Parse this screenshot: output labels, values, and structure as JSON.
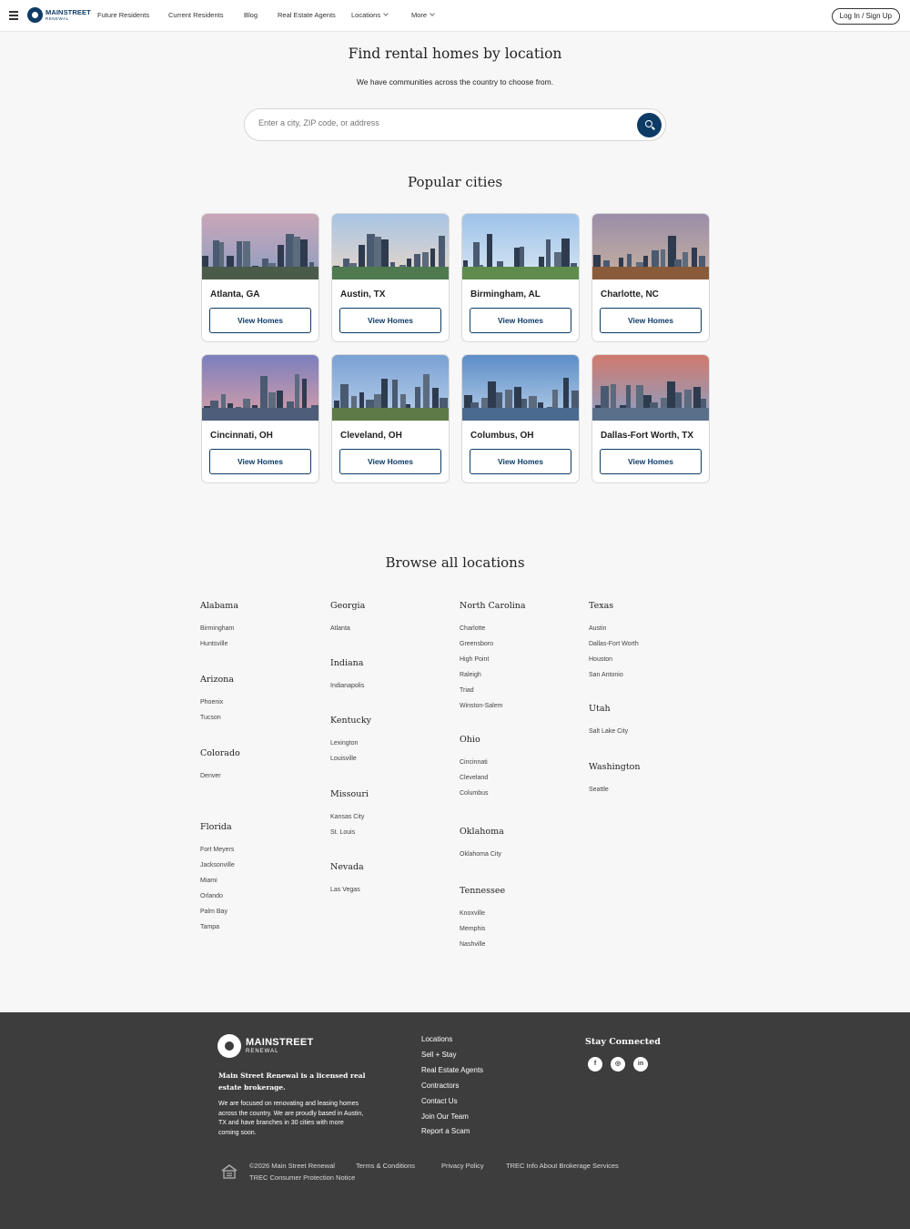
{
  "nav": {
    "brand_line1": "MAINSTREET",
    "brand_line2": "RENEWAL",
    "links": [
      "Future Residents",
      "Current Residents",
      "Blog",
      "Real Estate Agents",
      "Locations",
      "More"
    ],
    "login": "Log In / Sign Up"
  },
  "hero": {
    "title": "Find rental homes by location",
    "subtitle": "We have communities across the country to choose from.",
    "search_placeholder": "Enter a city, ZIP code, or address"
  },
  "popular": {
    "title": "Popular cities",
    "button_label": "View Homes",
    "cities": [
      "Atlanta, GA",
      "Austin, TX",
      "Birmingham, AL",
      "Charlotte, NC",
      "Cincinnati, OH",
      "Cleveland, OH",
      "Columbus, OH",
      "Dallas-Fort Worth, TX"
    ]
  },
  "browse": {
    "title": "Browse all locations",
    "states": [
      {
        "name": "Alabama",
        "cities": [
          "Birmingham",
          "Huntsville"
        ]
      },
      {
        "name": "Arizona",
        "cities": [
          "Phoenix",
          "Tucson"
        ]
      },
      {
        "name": "Colorado",
        "cities": [
          "Denver"
        ]
      },
      {
        "name": "Florida",
        "cities": [
          "Fort Meyers",
          "Jacksonville",
          "Miami",
          "Orlando",
          "Palm Bay",
          "Tampa"
        ]
      },
      {
        "name": "Georgia",
        "cities": [
          "Atlanta"
        ]
      },
      {
        "name": "Indiana",
        "cities": [
          "Indianapolis"
        ]
      },
      {
        "name": "Kentucky",
        "cities": [
          "Lexington",
          "Louisville"
        ]
      },
      {
        "name": "Missouri",
        "cities": [
          "Kansas City",
          "St. Louis"
        ]
      },
      {
        "name": "Nevada",
        "cities": [
          "Las Vegas"
        ]
      },
      {
        "name": "North Carolina",
        "cities": [
          "Charlotte",
          "Greensboro",
          "High Point",
          "Raleigh",
          "Triad",
          "Winston-Salem"
        ]
      },
      {
        "name": "Ohio",
        "cities": [
          "Cincinnati",
          "Cleveland",
          "Columbus"
        ]
      },
      {
        "name": "Oklahoma",
        "cities": [
          "Oklahoma City"
        ]
      },
      {
        "name": "Tennessee",
        "cities": [
          "Knoxville",
          "Memphis",
          "Nashville"
        ]
      },
      {
        "name": "Texas",
        "cities": [
          "Austin",
          "Dallas-Fort Worth",
          "Houston",
          "San Antonio"
        ]
      },
      {
        "name": "Utah",
        "cities": [
          "Salt Lake City"
        ]
      },
      {
        "name": "Washington",
        "cities": [
          "Seattle"
        ]
      }
    ]
  },
  "footer": {
    "brand_line1": "MAINSTREET",
    "brand_line2": "RENEWAL",
    "tagline": "Main Street Renewal is a licensed real estate brokerage.",
    "description": "We are focused on renovating and leasing homes across the country. We are proudly based in Austin, TX and have branches in 30 cities with more coming soon.",
    "links": [
      "Locations",
      "Sell + Stay",
      "Real Estate Agents",
      "Contractors",
      "Contact Us",
      "Join Our Team",
      "Report a Scam"
    ],
    "stay_connected": "Stay Connected",
    "social": [
      "facebook-icon",
      "instagram-icon",
      "linkedin-icon"
    ],
    "copyright": "©2026 Main Street Renewal",
    "legal": [
      "Terms & Conditions",
      "Privacy Policy",
      "TREC Info About Brokerage Services"
    ],
    "trec_notice": "TREC Consumer Protection Notice"
  },
  "colors": {
    "brand": "#0d3b66",
    "footer_bg": "#3d3d3d",
    "page_bg": "#f7f7f7"
  }
}
